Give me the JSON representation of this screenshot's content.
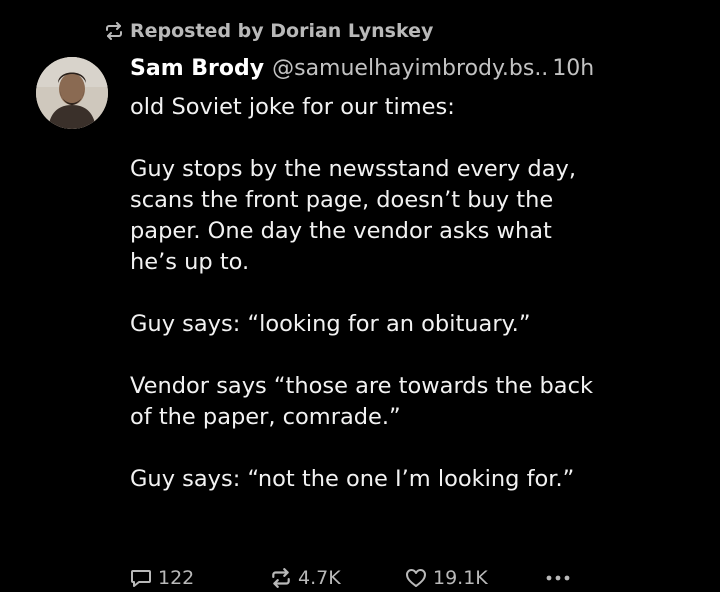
{
  "repost": {
    "label": "Reposted by Dorian Lynskey",
    "icon": "repost-icon"
  },
  "post": {
    "author_name": "Sam Brody",
    "handle": "@samuelhayimbrody.bs..",
    "time": "10h",
    "paragraphs": [
      [
        "old Soviet joke for our times:"
      ],
      [
        "Guy stops by the newsstand every day,",
        "scans the front page, doesn’t buy the",
        "paper. One day the vendor asks what",
        "he’s up to."
      ],
      [
        "Guy says: “looking for an obituary.”"
      ],
      [
        "Vendor says “those are towards the back",
        "of the paper, comrade.”"
      ],
      [
        "Guy says: “not the one I’m looking for.”"
      ]
    ]
  },
  "actions": {
    "replies": "122",
    "reposts": "4.7K",
    "likes": "19.1K",
    "reply_icon": "reply-icon",
    "repost_icon": "repost-icon",
    "like_icon": "heart-icon",
    "more_icon": "more-icon"
  },
  "colors": {
    "background": "#000000",
    "text": "#f2f2f2",
    "muted": "#b9b9b9"
  }
}
